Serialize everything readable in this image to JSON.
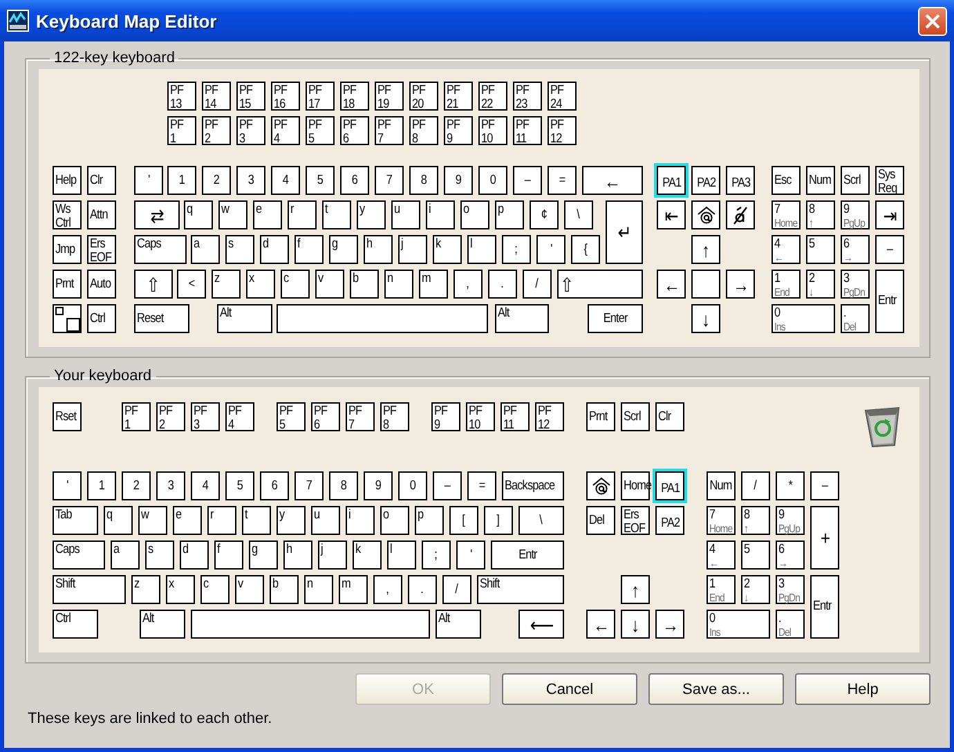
{
  "window": {
    "title": "Keyboard Map Editor"
  },
  "keyboard_122": {
    "title": "122-key keyboard",
    "keys": [
      {
        "kind": "text",
        "label": "PF",
        "label2": "13",
        "selected": false
      },
      {
        "kind": "text",
        "label": "PF",
        "label2": "14",
        "selected": false
      },
      {
        "kind": "text",
        "label": "PF",
        "label2": "15",
        "selected": false
      },
      {
        "kind": "text",
        "label": "PF",
        "label2": "16",
        "selected": false
      },
      {
        "kind": "text",
        "label": "PF",
        "label2": "17",
        "selected": false
      },
      {
        "kind": "text",
        "label": "PF",
        "label2": "18",
        "selected": false
      },
      {
        "kind": "text",
        "label": "PF",
        "label2": "19",
        "selected": false
      },
      {
        "kind": "text",
        "label": "PF",
        "label2": "20",
        "selected": false
      },
      {
        "kind": "text",
        "label": "PF",
        "label2": "21",
        "selected": false
      },
      {
        "kind": "text",
        "label": "PF",
        "label2": "22",
        "selected": false
      },
      {
        "kind": "text",
        "label": "PF",
        "label2": "23",
        "selected": false
      },
      {
        "kind": "text",
        "label": "PF",
        "label2": "24",
        "selected": false
      },
      {
        "kind": "text",
        "label": "PF",
        "label2": "1",
        "selected": false
      },
      {
        "kind": "text",
        "label": "PF",
        "label2": "2",
        "selected": false
      },
      {
        "kind": "text",
        "label": "PF",
        "label2": "3",
        "selected": false
      },
      {
        "kind": "text",
        "label": "PF",
        "label2": "4",
        "selected": false
      },
      {
        "kind": "text",
        "label": "PF",
        "label2": "5",
        "selected": false
      },
      {
        "kind": "text",
        "label": "PF",
        "label2": "6",
        "selected": false
      },
      {
        "kind": "text",
        "label": "PF",
        "label2": "7",
        "selected": false
      },
      {
        "kind": "text",
        "label": "PF",
        "label2": "8",
        "selected": false
      },
      {
        "kind": "text",
        "label": "PF",
        "label2": "9",
        "selected": false
      },
      {
        "kind": "text",
        "label": "PF",
        "label2": "10",
        "selected": false
      },
      {
        "kind": "text",
        "label": "PF",
        "label2": "11",
        "selected": false
      },
      {
        "kind": "text",
        "label": "PF",
        "label2": "12",
        "selected": false
      },
      {
        "kind": "text",
        "label": "Help",
        "selected": false
      },
      {
        "kind": "text",
        "label": "Clr",
        "selected": false
      },
      {
        "kind": "text",
        "label": "'",
        "selected": false
      },
      {
        "kind": "text",
        "label": "1",
        "selected": false
      },
      {
        "kind": "text",
        "label": "2",
        "selected": false
      },
      {
        "kind": "text",
        "label": "3",
        "selected": false
      },
      {
        "kind": "text",
        "label": "4",
        "selected": false
      },
      {
        "kind": "text",
        "label": "5",
        "selected": false
      },
      {
        "kind": "text",
        "label": "6",
        "selected": false
      },
      {
        "kind": "text",
        "label": "7",
        "selected": false
      },
      {
        "kind": "text",
        "label": "8",
        "selected": false
      },
      {
        "kind": "text",
        "label": "9",
        "selected": false
      },
      {
        "kind": "text",
        "label": "0",
        "selected": false
      },
      {
        "kind": "text",
        "label": "–",
        "selected": false
      },
      {
        "kind": "text",
        "label": "=",
        "selected": false
      },
      {
        "kind": "symbol",
        "label": "←",
        "selected": false
      },
      {
        "kind": "text",
        "label": "PA1",
        "selected": true
      },
      {
        "kind": "text",
        "label": "PA2",
        "selected": false
      },
      {
        "kind": "text",
        "label": "PA3",
        "selected": false
      },
      {
        "kind": "text",
        "label": "Esc",
        "selected": false
      },
      {
        "kind": "text",
        "label": "Num",
        "selected": false
      },
      {
        "kind": "text",
        "label": "Scrl",
        "selected": false
      },
      {
        "kind": "text",
        "label": "Sys",
        "label2": "Req",
        "selected": false
      },
      {
        "kind": "text",
        "label": "Ws",
        "label2": "Ctrl",
        "selected": false
      },
      {
        "kind": "text",
        "label": "Attn",
        "selected": false
      },
      {
        "kind": "symbol",
        "label": "⇄",
        "selected": false
      },
      {
        "kind": "text",
        "label": "q",
        "selected": false
      },
      {
        "kind": "text",
        "label": "w",
        "selected": false
      },
      {
        "kind": "text",
        "label": "e",
        "selected": false
      },
      {
        "kind": "text",
        "label": "r",
        "selected": false
      },
      {
        "kind": "text",
        "label": "t",
        "selected": false
      },
      {
        "kind": "text",
        "label": "y",
        "selected": false
      },
      {
        "kind": "text",
        "label": "u",
        "selected": false
      },
      {
        "kind": "text",
        "label": "i",
        "selected": false
      },
      {
        "kind": "text",
        "label": "o",
        "selected": false
      },
      {
        "kind": "text",
        "label": "p",
        "selected": false
      },
      {
        "kind": "text",
        "label": "¢",
        "selected": false
      },
      {
        "kind": "text",
        "label": "\\",
        "selected": false
      },
      {
        "kind": "symbol",
        "label": "↵",
        "selected": false
      },
      {
        "kind": "symbol",
        "label": "⇤",
        "selected": false
      },
      {
        "kind": "at",
        "selected": false
      },
      {
        "kind": "crossed",
        "selected": false
      },
      {
        "kind": "text",
        "label": "7",
        "sub": "Home",
        "selected": false
      },
      {
        "kind": "text",
        "label": "8",
        "sub": "↑",
        "selected": false
      },
      {
        "kind": "text",
        "label": "9",
        "sub": "PgUp",
        "selected": false
      },
      {
        "kind": "symbol",
        "label": "⇥",
        "selected": false
      },
      {
        "kind": "text",
        "label": "Jmp",
        "selected": false
      },
      {
        "kind": "text",
        "label": "Ers",
        "label2": "EOF",
        "selected": false
      },
      {
        "kind": "text",
        "label": "Caps",
        "selected": false
      },
      {
        "kind": "text",
        "label": "a",
        "selected": false
      },
      {
        "kind": "text",
        "label": "s",
        "selected": false
      },
      {
        "kind": "text",
        "label": "d",
        "selected": false
      },
      {
        "kind": "text",
        "label": "f",
        "selected": false
      },
      {
        "kind": "text",
        "label": "g",
        "selected": false
      },
      {
        "kind": "text",
        "label": "h",
        "selected": false
      },
      {
        "kind": "text",
        "label": "j",
        "selected": false
      },
      {
        "kind": "text",
        "label": "k",
        "selected": false
      },
      {
        "kind": "text",
        "label": "l",
        "selected": false
      },
      {
        "kind": "text",
        "label": ";",
        "selected": false
      },
      {
        "kind": "text",
        "label": "'",
        "selected": false
      },
      {
        "kind": "text",
        "label": "{",
        "selected": false
      },
      {
        "kind": "symbol",
        "label": "↑",
        "selected": false
      },
      {
        "kind": "text",
        "label": "4",
        "sub": "←",
        "selected": false
      },
      {
        "kind": "text",
        "label": "5",
        "selected": false
      },
      {
        "kind": "text",
        "label": "6",
        "sub": "→",
        "selected": false
      },
      {
        "kind": "text",
        "label": "–",
        "selected": false
      },
      {
        "kind": "text",
        "label": "Prnt",
        "selected": false
      },
      {
        "kind": "text",
        "label": "Auto",
        "selected": false
      },
      {
        "kind": "symbol",
        "label": "⇧",
        "selected": false
      },
      {
        "kind": "text",
        "label": "<",
        "selected": false
      },
      {
        "kind": "text",
        "label": "z",
        "selected": false
      },
      {
        "kind": "text",
        "label": "x",
        "selected": false
      },
      {
        "kind": "text",
        "label": "c",
        "selected": false
      },
      {
        "kind": "text",
        "label": "v",
        "selected": false
      },
      {
        "kind": "text",
        "label": "b",
        "selected": false
      },
      {
        "kind": "text",
        "label": "n",
        "selected": false
      },
      {
        "kind": "text",
        "label": "m",
        "selected": false
      },
      {
        "kind": "text",
        "label": ",",
        "selected": false
      },
      {
        "kind": "text",
        "label": ".",
        "selected": false
      },
      {
        "kind": "text",
        "label": "/",
        "selected": false
      },
      {
        "kind": "symbol",
        "label": "⇧",
        "selected": false
      },
      {
        "kind": "symbol",
        "label": "←",
        "selected": false
      },
      {
        "kind": "blank",
        "selected": false
      },
      {
        "kind": "symbol",
        "label": "→",
        "selected": false
      },
      {
        "kind": "text",
        "label": "1",
        "sub": "End",
        "selected": false
      },
      {
        "kind": "text",
        "label": "2",
        "sub": "↓",
        "selected": false
      },
      {
        "kind": "text",
        "label": "3",
        "sub": "PgDn",
        "selected": false
      },
      {
        "kind": "text",
        "label": "Entr",
        "selected": false
      },
      {
        "kind": "corner",
        "selected": false
      },
      {
        "kind": "text",
        "label": "Ctrl",
        "selected": false
      },
      {
        "kind": "text",
        "label": "Reset",
        "selected": false
      },
      {
        "kind": "text",
        "label": "Alt",
        "selected": false
      },
      {
        "kind": "blank",
        "selected": false
      },
      {
        "kind": "text",
        "label": "Alt",
        "selected": false
      },
      {
        "kind": "text",
        "label": "Enter",
        "selected": false
      },
      {
        "kind": "symbol",
        "label": "↓",
        "selected": false
      },
      {
        "kind": "text",
        "label": "0",
        "sub": "Ins",
        "selected": false
      },
      {
        "kind": "text",
        "label": ".",
        "sub": "Del",
        "selected": false
      }
    ]
  },
  "your_keyboard": {
    "title": "Your keyboard",
    "keys": [
      {
        "kind": "text",
        "label": "Rset",
        "selected": false
      },
      {
        "kind": "text",
        "label": "PF",
        "label2": "1",
        "selected": false
      },
      {
        "kind": "text",
        "label": "PF",
        "label2": "2",
        "selected": false
      },
      {
        "kind": "text",
        "label": "PF",
        "label2": "3",
        "selected": false
      },
      {
        "kind": "text",
        "label": "PF",
        "label2": "4",
        "selected": false
      },
      {
        "kind": "text",
        "label": "PF",
        "label2": "5",
        "selected": false
      },
      {
        "kind": "text",
        "label": "PF",
        "label2": "6",
        "selected": false
      },
      {
        "kind": "text",
        "label": "PF",
        "label2": "7",
        "selected": false
      },
      {
        "kind": "text",
        "label": "PF",
        "label2": "8",
        "selected": false
      },
      {
        "kind": "text",
        "label": "PF",
        "label2": "9",
        "selected": false
      },
      {
        "kind": "text",
        "label": "PF",
        "label2": "10",
        "selected": false
      },
      {
        "kind": "text",
        "label": "PF",
        "label2": "11",
        "selected": false
      },
      {
        "kind": "text",
        "label": "PF",
        "label2": "12",
        "selected": false
      },
      {
        "kind": "text",
        "label": "Prnt",
        "selected": false
      },
      {
        "kind": "text",
        "label": "Scrl",
        "selected": false
      },
      {
        "kind": "text",
        "label": "Clr",
        "selected": false
      },
      {
        "kind": "text",
        "label": "'",
        "selected": false
      },
      {
        "kind": "text",
        "label": "1",
        "selected": false
      },
      {
        "kind": "text",
        "label": "2",
        "selected": false
      },
      {
        "kind": "text",
        "label": "3",
        "selected": false
      },
      {
        "kind": "text",
        "label": "4",
        "selected": false
      },
      {
        "kind": "text",
        "label": "5",
        "selected": false
      },
      {
        "kind": "text",
        "label": "6",
        "selected": false
      },
      {
        "kind": "text",
        "label": "7",
        "selected": false
      },
      {
        "kind": "text",
        "label": "8",
        "selected": false
      },
      {
        "kind": "text",
        "label": "9",
        "selected": false
      },
      {
        "kind": "text",
        "label": "0",
        "selected": false
      },
      {
        "kind": "text",
        "label": "–",
        "selected": false
      },
      {
        "kind": "text",
        "label": "=",
        "selected": false
      },
      {
        "kind": "text",
        "label": "Backspace",
        "selected": false
      },
      {
        "kind": "at",
        "selected": false
      },
      {
        "kind": "text",
        "label": "Home",
        "selected": false
      },
      {
        "kind": "text",
        "label": "PA1",
        "selected": true
      },
      {
        "kind": "text",
        "label": "Num",
        "selected": false
      },
      {
        "kind": "text",
        "label": "/",
        "selected": false
      },
      {
        "kind": "text",
        "label": "*",
        "selected": false
      },
      {
        "kind": "text",
        "label": "–",
        "selected": false
      },
      {
        "kind": "text",
        "label": "Tab",
        "selected": false
      },
      {
        "kind": "text",
        "label": "q",
        "selected": false
      },
      {
        "kind": "text",
        "label": "w",
        "selected": false
      },
      {
        "kind": "text",
        "label": "e",
        "selected": false
      },
      {
        "kind": "text",
        "label": "r",
        "selected": false
      },
      {
        "kind": "text",
        "label": "t",
        "selected": false
      },
      {
        "kind": "text",
        "label": "y",
        "selected": false
      },
      {
        "kind": "text",
        "label": "u",
        "selected": false
      },
      {
        "kind": "text",
        "label": "i",
        "selected": false
      },
      {
        "kind": "text",
        "label": "o",
        "selected": false
      },
      {
        "kind": "text",
        "label": "p",
        "selected": false
      },
      {
        "kind": "text",
        "label": "[",
        "selected": false
      },
      {
        "kind": "text",
        "label": "]",
        "selected": false
      },
      {
        "kind": "text",
        "label": "\\",
        "selected": false
      },
      {
        "kind": "text",
        "label": "Del",
        "selected": false
      },
      {
        "kind": "text",
        "label": "Ers",
        "label2": "EOF",
        "selected": false
      },
      {
        "kind": "text",
        "label": "PA2",
        "selected": false
      },
      {
        "kind": "text",
        "label": "7",
        "sub": "Home",
        "selected": false
      },
      {
        "kind": "text",
        "label": "8",
        "sub": "↑",
        "selected": false
      },
      {
        "kind": "text",
        "label": "9",
        "sub": "PgUp",
        "selected": false
      },
      {
        "kind": "symbol",
        "label": "+",
        "selected": false
      },
      {
        "kind": "text",
        "label": "Caps",
        "selected": false
      },
      {
        "kind": "text",
        "label": "a",
        "selected": false
      },
      {
        "kind": "text",
        "label": "s",
        "selected": false
      },
      {
        "kind": "text",
        "label": "d",
        "selected": false
      },
      {
        "kind": "text",
        "label": "f",
        "selected": false
      },
      {
        "kind": "text",
        "label": "g",
        "selected": false
      },
      {
        "kind": "text",
        "label": "h",
        "selected": false
      },
      {
        "kind": "text",
        "label": "j",
        "selected": false
      },
      {
        "kind": "text",
        "label": "k",
        "selected": false
      },
      {
        "kind": "text",
        "label": "l",
        "selected": false
      },
      {
        "kind": "text",
        "label": ";",
        "selected": false
      },
      {
        "kind": "text",
        "label": "'",
        "selected": false
      },
      {
        "kind": "text",
        "label": "Entr",
        "selected": false
      },
      {
        "kind": "text",
        "label": "4",
        "sub": "←",
        "selected": false
      },
      {
        "kind": "text",
        "label": "5",
        "selected": false
      },
      {
        "kind": "text",
        "label": "6",
        "sub": "→",
        "selected": false
      },
      {
        "kind": "text",
        "label": "Shift",
        "selected": false
      },
      {
        "kind": "text",
        "label": "z",
        "selected": false
      },
      {
        "kind": "text",
        "label": "x",
        "selected": false
      },
      {
        "kind": "text",
        "label": "c",
        "selected": false
      },
      {
        "kind": "text",
        "label": "v",
        "selected": false
      },
      {
        "kind": "text",
        "label": "b",
        "selected": false
      },
      {
        "kind": "text",
        "label": "n",
        "selected": false
      },
      {
        "kind": "text",
        "label": "m",
        "selected": false
      },
      {
        "kind": "text",
        "label": ",",
        "selected": false
      },
      {
        "kind": "text",
        "label": ".",
        "selected": false
      },
      {
        "kind": "text",
        "label": "/",
        "selected": false
      },
      {
        "kind": "text",
        "label": "Shift",
        "selected": false
      },
      {
        "kind": "symbol",
        "label": "↑",
        "selected": false
      },
      {
        "kind": "text",
        "label": "1",
        "sub": "End",
        "selected": false
      },
      {
        "kind": "text",
        "label": "2",
        "sub": "↓",
        "selected": false
      },
      {
        "kind": "text",
        "label": "3",
        "sub": "PgDn",
        "selected": false
      },
      {
        "kind": "text",
        "label": "Entr",
        "selected": false
      },
      {
        "kind": "text",
        "label": "Ctrl",
        "selected": false
      },
      {
        "kind": "text",
        "label": "Alt",
        "selected": false
      },
      {
        "kind": "blank",
        "selected": false
      },
      {
        "kind": "text",
        "label": "Alt",
        "selected": false
      },
      {
        "kind": "symbol",
        "label": "⟵",
        "selected": false
      },
      {
        "kind": "symbol",
        "label": "←",
        "selected": false
      },
      {
        "kind": "symbol",
        "label": "↓",
        "selected": false
      },
      {
        "kind": "symbol",
        "label": "→",
        "selected": false
      },
      {
        "kind": "text",
        "label": "0",
        "sub": "Ins",
        "selected": false
      },
      {
        "kind": "text",
        "label": ".",
        "sub": "Del",
        "selected": false
      }
    ]
  },
  "buttons": [
    {
      "label": "OK",
      "disabled": true
    },
    {
      "label": "Cancel",
      "disabled": false
    },
    {
      "label": "Save as...",
      "disabled": false
    },
    {
      "label": "Help",
      "disabled": false
    }
  ],
  "status": "These keys are linked to each other."
}
